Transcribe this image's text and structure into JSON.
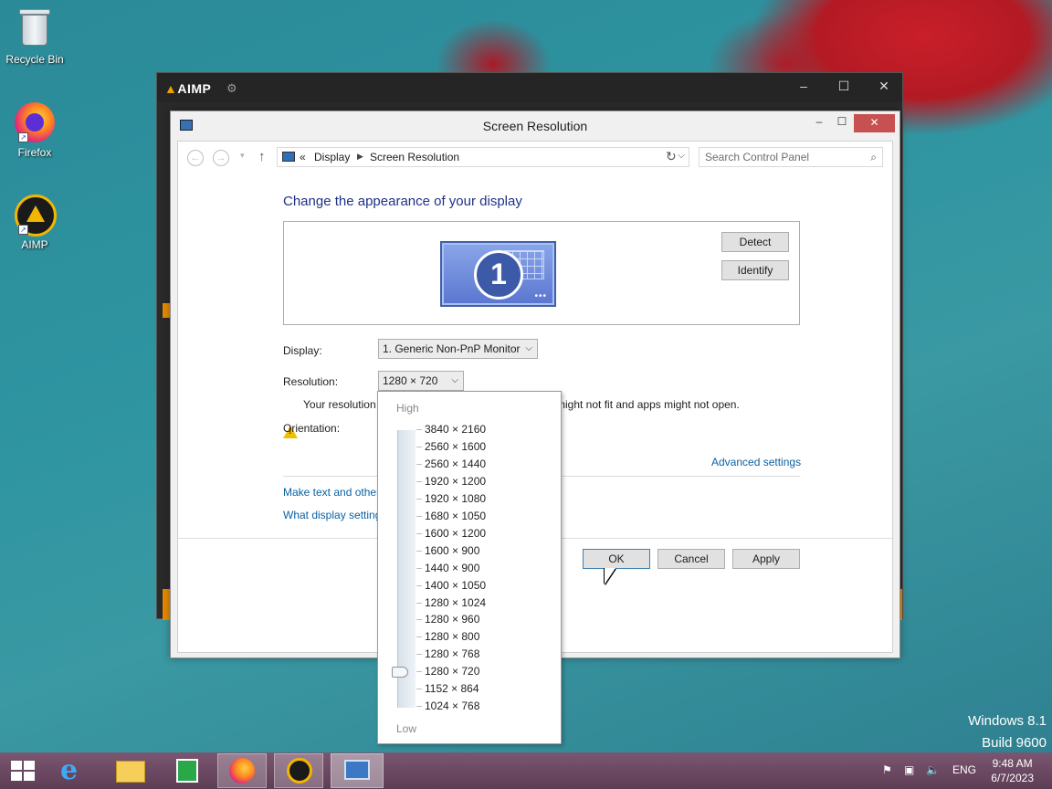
{
  "desktop": {
    "icons": [
      {
        "label": "Recycle Bin"
      },
      {
        "label": "Firefox"
      },
      {
        "label": "AIMP"
      }
    ],
    "watermark": {
      "line1": "Windows 8.1",
      "line2": "Build 9600"
    }
  },
  "aimp": {
    "logo": "AIMP",
    "controls": {
      "minimize": "–",
      "maximize": "☐",
      "close": "✕"
    }
  },
  "dialog": {
    "title": "Screen Resolution",
    "controls": {
      "minimize": "–",
      "maximize": "☐",
      "close": "✕"
    },
    "address": {
      "prefix": "«",
      "crumbs": [
        "Display",
        "Screen Resolution"
      ]
    },
    "search_placeholder": "Search Control Panel",
    "heading": "Change the appearance of your display",
    "monitor_number": "1",
    "detect_label": "Detect",
    "identify_label": "Identify",
    "display_label": "Display:",
    "display_value": "1. Generic Non-PnP Monitor",
    "resolution_label": "Resolution:",
    "resolution_value": "1280 × 720",
    "warning_start": "Your resolution",
    "warning_end": "might not fit and apps might not open.",
    "orientation_label": "Orientation:",
    "advanced_link": "Advanced settings",
    "link_text_size": "Make text and other",
    "link_display_settings": "What display setting",
    "ok_label": "OK",
    "cancel_label": "Cancel",
    "apply_label": "Apply"
  },
  "resolution_dropdown": {
    "high_label": "High",
    "low_label": "Low",
    "selected": "1280 × 720",
    "options": [
      "3840 × 2160",
      "2560 × 1600",
      "2560 × 1440",
      "1920 × 1200",
      "1920 × 1080",
      "1680 × 1050",
      "1600 × 1200",
      "1600 × 900",
      "1440 × 900",
      "1400 × 1050",
      "1280 × 1024",
      "1280 × 960",
      "1280 × 800",
      "1280 × 768",
      "1280 × 720",
      "1152 × 864",
      "1024 × 768"
    ]
  },
  "taskbar": {
    "language": "ENG",
    "time": "9:48 AM",
    "date": "6/7/2023"
  },
  "colors": {
    "accent": "#1e3287",
    "link": "#0b61a4",
    "aimp_orange": "#e58a00"
  }
}
